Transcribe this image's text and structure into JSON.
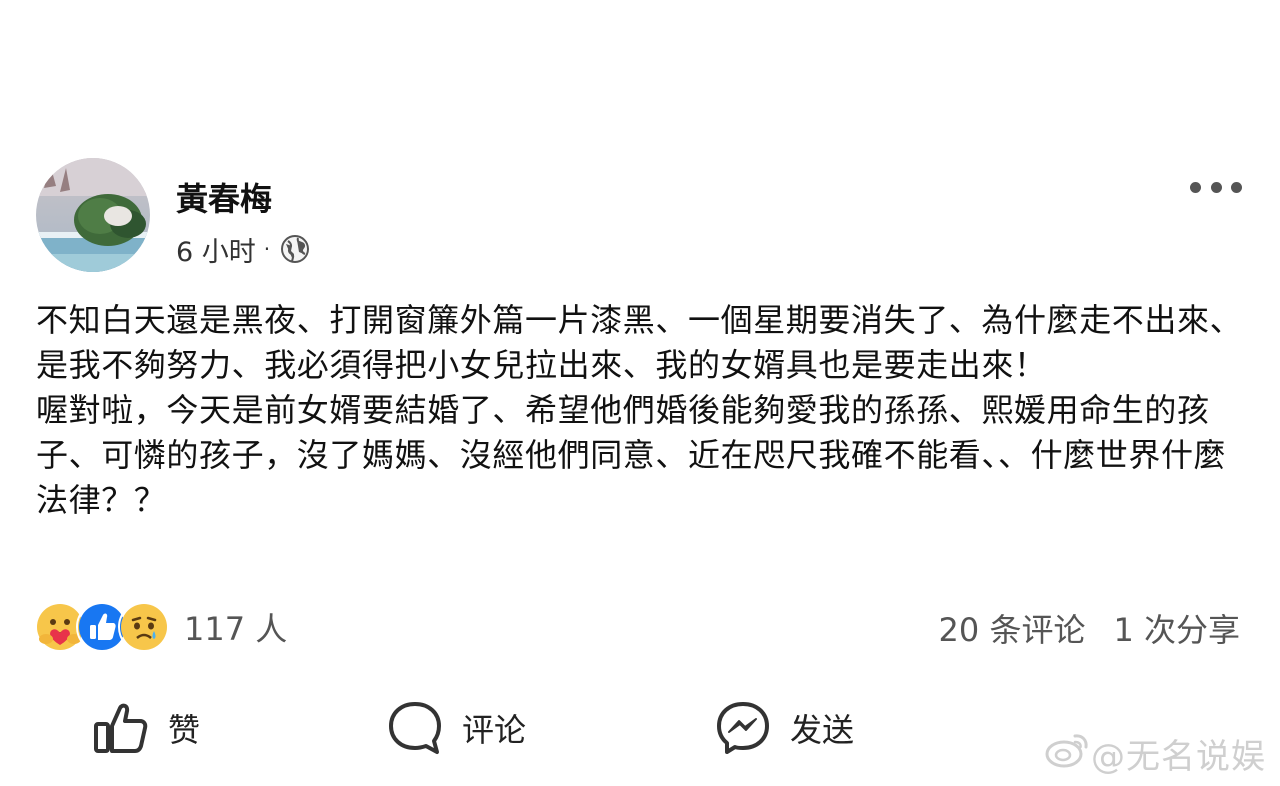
{
  "author": {
    "name": "黃春梅"
  },
  "meta": {
    "time": "6 小时",
    "separator": "·",
    "audience_icon": "globe-icon"
  },
  "post": {
    "paragraphs": [
      "不知白天還是黑夜、打開窗簾外篇一片漆黑、一個星期要消失了、為什麼走不出來、是我不夠努力、我必須得把小女兒拉出來、我的女婿具也是要走出來！",
      "喔對啦，今天是前女婿要結婚了、希望他們婚後能夠愛我的孫孫、熙媛用命生的孩子、可憐的孩子，沒了媽媽、沒經他們同意、近在咫尺我確不能看、、什麼世界什麼法律？？"
    ]
  },
  "reactions": {
    "icons": [
      "care-emoji-icon",
      "like-emoji-icon",
      "sad-emoji-icon"
    ],
    "count_text": "117 人"
  },
  "stats": {
    "comments": "20 条评论",
    "shares": "1 次分享"
  },
  "actions": {
    "like": "赞",
    "comment": "评论",
    "send": "发送"
  },
  "watermark": {
    "text": "@无名说娱",
    "icon": "weibo-logo-icon"
  },
  "colors": {
    "like_blue": "#1877f2",
    "emoji_yellow": "#f7c64a",
    "care_red": "#e8334a"
  }
}
